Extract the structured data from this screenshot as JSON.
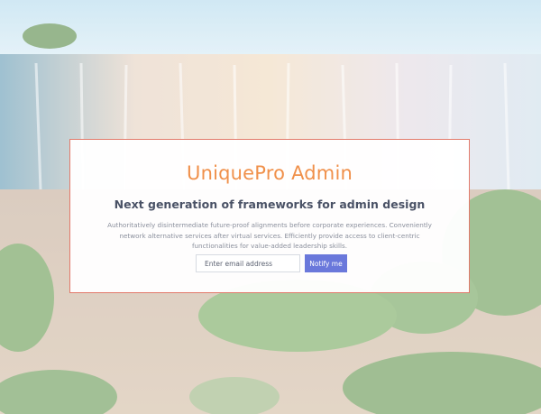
{
  "hero": {
    "title": "UniquePro Admin",
    "subtitle": "Next generation of frameworks for admin design",
    "description": "Authoritatively disintermediate future-proof alignments before corporate experiences. Conveniently network alternative services after virtual services. Efficiently provide access to client-centric functionalities for value-added leadership skills.",
    "email_placeholder": "Enter email address",
    "notify_label": "Notify me"
  },
  "colors": {
    "title": "#f0904a",
    "button": "#6a78db",
    "card_border": "#e27a6b"
  }
}
